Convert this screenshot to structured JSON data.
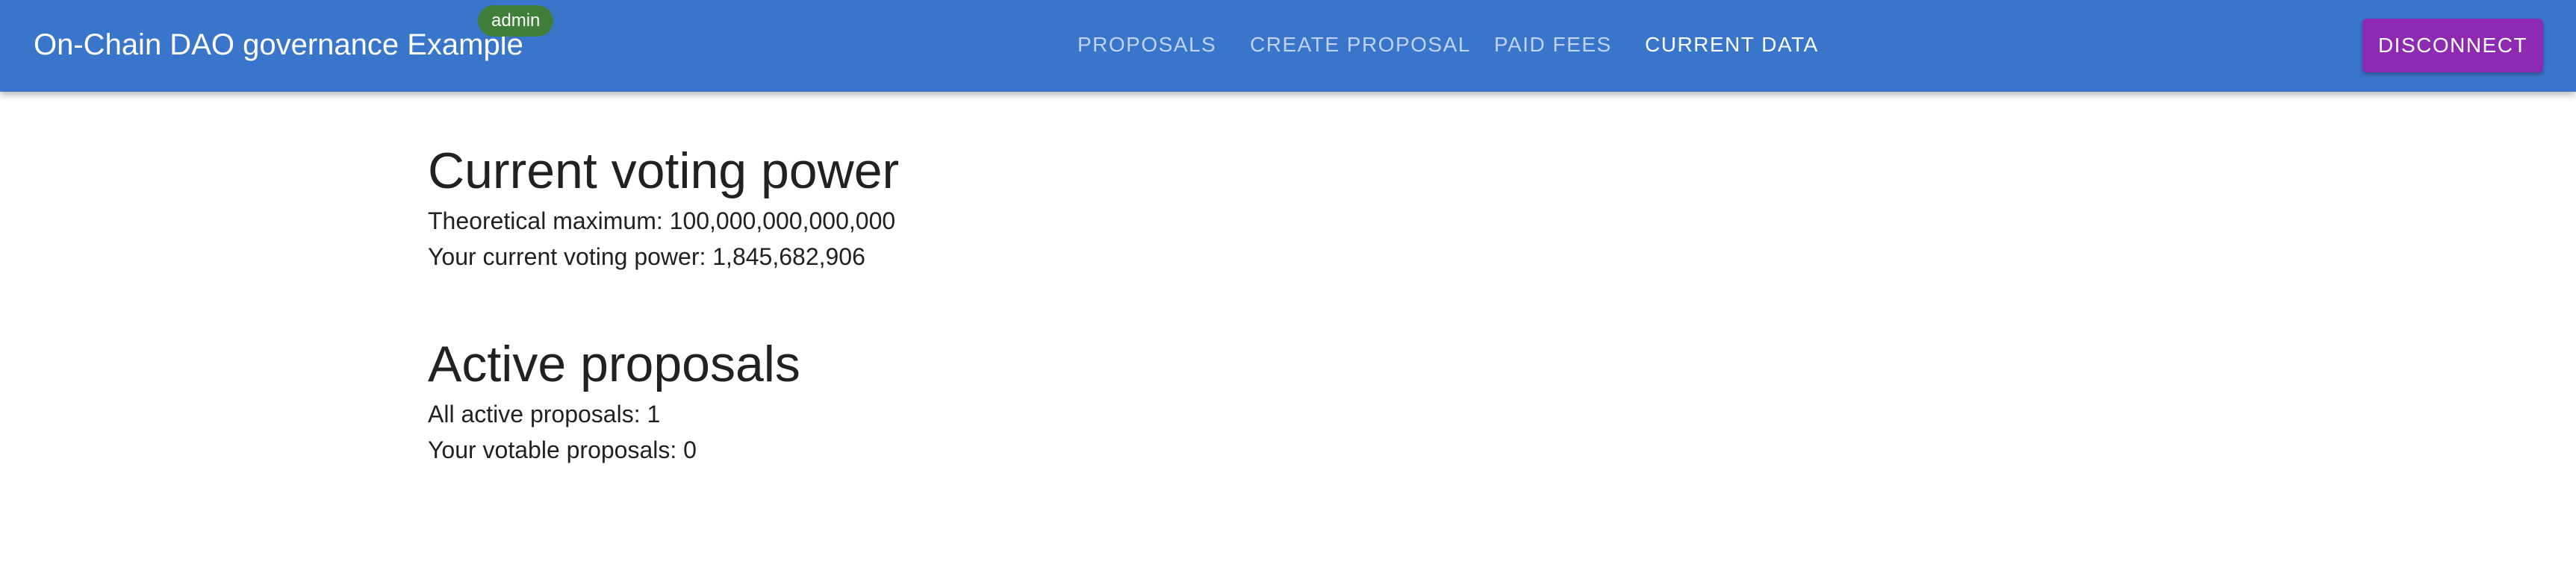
{
  "header": {
    "title": "On-Chain DAO governance Example",
    "badge": "admin",
    "nav": [
      {
        "label": "Proposals",
        "active": false
      },
      {
        "label": "Create Proposal",
        "active": false
      },
      {
        "label": "Paid Fees",
        "active": false
      },
      {
        "label": "Current Data",
        "active": true
      }
    ],
    "disconnect_label": "Disconnect",
    "colors": {
      "bar": "#3a75cc",
      "badge": "#3f7f3a",
      "button": "#8e2ab2"
    }
  },
  "voting_power": {
    "heading": "Current voting power",
    "theoretical_maximum": "Theoretical maximum: 100,000,000,000,000",
    "current": "Your current voting power: 1,845,682,906"
  },
  "active_proposals": {
    "heading": "Active proposals",
    "all": "All active proposals: 1",
    "votable": "Your votable proposals: 0"
  }
}
